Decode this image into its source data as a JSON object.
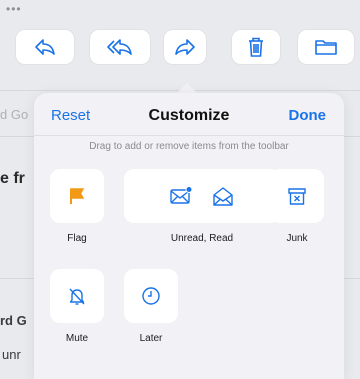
{
  "toolbar": {
    "menu_dots": "•••",
    "buttons": [
      {
        "name": "reply-button",
        "icon": "reply-icon"
      },
      {
        "name": "reply-all-button",
        "icon": "reply-all-icon"
      },
      {
        "name": "forward-button",
        "icon": "forward-icon"
      },
      {
        "name": "trash-button",
        "icon": "trash-icon"
      },
      {
        "name": "folder-button",
        "icon": "folder-icon"
      }
    ]
  },
  "background": {
    "snippet_1": "d Go",
    "snippet_2": "e fr",
    "snippet_3": "rd G",
    "snippet_4": "unr"
  },
  "popover": {
    "reset_label": "Reset",
    "title": "Customize",
    "done_label": "Done",
    "hint": "Drag to add or remove items from the toolbar",
    "items": [
      {
        "label": "Flag",
        "icon": "flag-icon"
      },
      {
        "label": "Unread, Read",
        "icon": "unread-read-icons"
      },
      {
        "label": "Junk",
        "icon": "junk-icon"
      },
      {
        "label": "Mute",
        "icon": "mute-bell-icon"
      },
      {
        "label": "Later",
        "icon": "clock-icon"
      }
    ]
  },
  "colors": {
    "accent": "#1a73e8",
    "flag": "#f29a16",
    "popover_bg": "#f2f2f6",
    "page_bg": "#e9eaee"
  }
}
